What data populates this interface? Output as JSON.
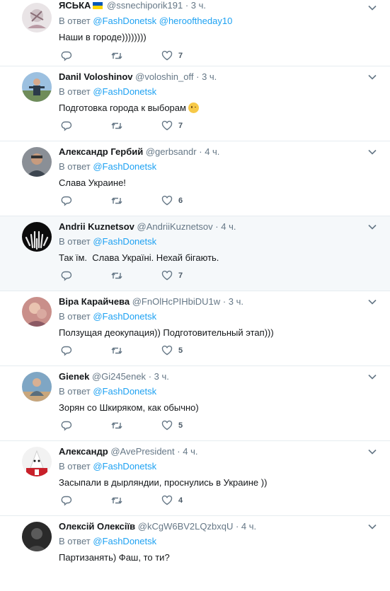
{
  "colors": {
    "link": "#1da1f2",
    "muted": "#657786",
    "text": "#14171a",
    "divider": "#e6ecf0",
    "highlight": "#f5f8fa"
  },
  "icons": {
    "reply": "reply-icon",
    "retweet": "retweet-icon",
    "like": "heart-icon",
    "menu": "chevron-down-icon"
  },
  "tweets": [
    {
      "name": "ЯСЬКА",
      "flag": true,
      "handle": "@ssnechiporik191",
      "sep": "·",
      "time": "3 ч.",
      "reply_prefix": "В ответ",
      "reply_to": [
        "@FashDonetsk",
        "@herooftheday10"
      ],
      "text": "Наши в городе))))))))",
      "likes": "7"
    },
    {
      "name": "Danil Voloshinov",
      "handle": "@voloshin_off",
      "sep": "·",
      "time": "3 ч.",
      "reply_prefix": "В ответ",
      "reply_to": [
        "@FashDonetsk"
      ],
      "text": "Подготовка города к выборам",
      "emoji": "winking-face-emoji",
      "likes": "7"
    },
    {
      "name": "Александр Гербий",
      "handle": "@gerbsandr",
      "sep": "·",
      "time": "4 ч.",
      "reply_prefix": "В ответ",
      "reply_to": [
        "@FashDonetsk"
      ],
      "text": "Слава Украине!",
      "likes": "6"
    },
    {
      "name": "Andrii Kuznetsov",
      "handle": "@AndriiKuznetsov",
      "sep": "·",
      "time": "4 ч.",
      "reply_prefix": "В ответ",
      "reply_to": [
        "@FashDonetsk"
      ],
      "text": "Так їм.  Слава Україні. Нехай бігають.",
      "likes": "7"
    },
    {
      "name": "Віра Карайчева",
      "handle": "@FnOlHcPIHbiDU1w",
      "sep": "·",
      "time": "3 ч.",
      "reply_prefix": "В ответ",
      "reply_to": [
        "@FashDonetsk"
      ],
      "text": "Ползущая деокупация)) Подготовительный этап)))",
      "likes": "5"
    },
    {
      "name": "Gienek",
      "handle": "@Gi245enek",
      "sep": "·",
      "time": "3 ч.",
      "reply_prefix": "В ответ",
      "reply_to": [
        "@FashDonetsk"
      ],
      "text": "Зорян со Шкиряком, как обычно)",
      "likes": "5"
    },
    {
      "name": "Александр",
      "handle": "@AvePresident",
      "sep": "·",
      "time": "4 ч.",
      "reply_prefix": "В ответ",
      "reply_to": [
        "@FashDonetsk"
      ],
      "text": "Засыпали в дырляндии, проснулись в Украине ))",
      "likes": "4"
    },
    {
      "name": "Олексій Олексіїв",
      "handle": "@kCgW6BV2LQzbxqU",
      "sep": "·",
      "time": "4 ч.",
      "reply_prefix": "В ответ",
      "reply_to": [
        "@FashDonetsk"
      ],
      "text": "Партизанять) Фаш, то ти?",
      "likes": ""
    }
  ]
}
